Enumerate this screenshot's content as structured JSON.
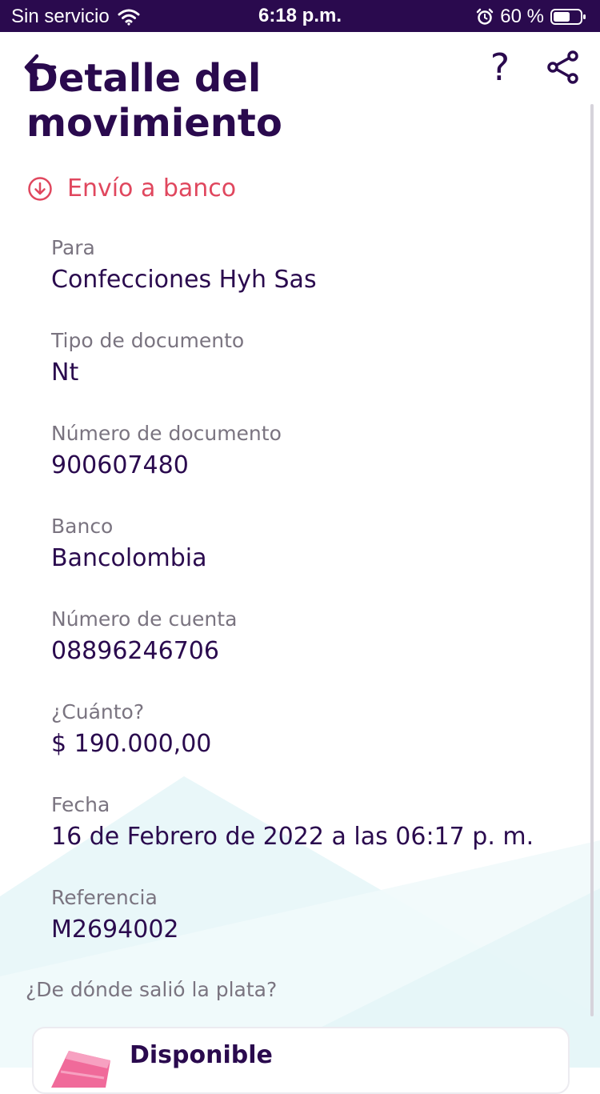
{
  "status_bar": {
    "carrier": "Sin servicio",
    "time": "6:18 p.m.",
    "battery": "60 %"
  },
  "header": {
    "title_line1": "Detalle del",
    "title_line2": "movimiento"
  },
  "movement": {
    "type_label": "Envío a banco"
  },
  "details": [
    {
      "label": "Para",
      "value": "Confecciones Hyh Sas"
    },
    {
      "label": "Tipo de documento",
      "value": "Nt"
    },
    {
      "label": "Número de documento",
      "value": "900607480"
    },
    {
      "label": "Banco",
      "value": "Bancolombia"
    },
    {
      "label": "Número de cuenta",
      "value": "08896246706"
    },
    {
      "label": "¿Cuánto?",
      "value": "$ 190.000,00"
    },
    {
      "label": "Fecha",
      "value": "16 de Febrero de 2022 a las 06:17 p. m."
    },
    {
      "label": "Referencia",
      "value": "M2694002"
    }
  ],
  "source": {
    "question": "¿De dónde salió la plata?",
    "card_title": "Disponible"
  },
  "colors": {
    "primary": "#2a0a4e",
    "accent": "#e0475e",
    "label": "#7a7480"
  },
  "icons": {
    "back": "arrow-left-icon",
    "help": "question-mark-icon",
    "share": "share-icon",
    "type": "arrow-down-circle-icon"
  }
}
